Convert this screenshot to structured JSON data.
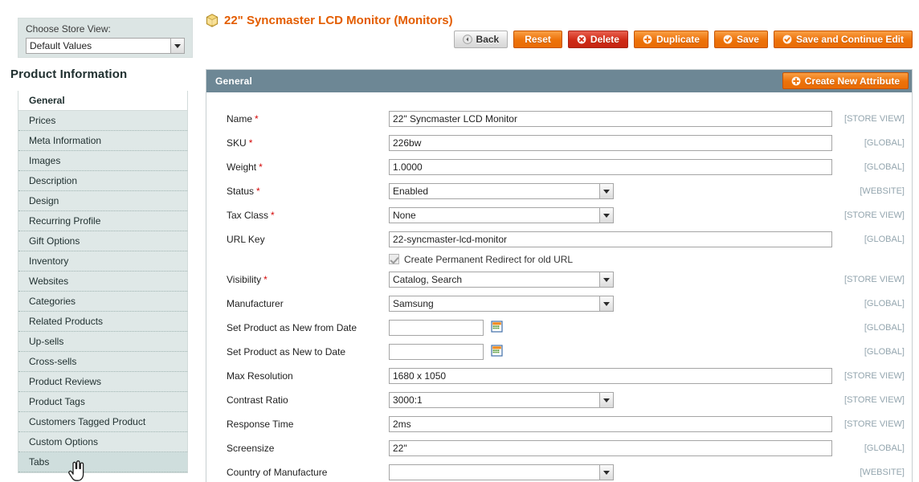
{
  "store_view": {
    "label": "Choose Store View:",
    "selected": "Default Values"
  },
  "sidebar": {
    "title": "Product Information",
    "items": [
      {
        "label": "General",
        "state": "active"
      },
      {
        "label": "Prices",
        "state": "normal"
      },
      {
        "label": "Meta Information",
        "state": "normal"
      },
      {
        "label": "Images",
        "state": "normal"
      },
      {
        "label": "Description",
        "state": "normal"
      },
      {
        "label": "Design",
        "state": "normal"
      },
      {
        "label": "Recurring Profile",
        "state": "normal"
      },
      {
        "label": "Gift Options",
        "state": "normal"
      },
      {
        "label": "Inventory",
        "state": "normal"
      },
      {
        "label": "Websites",
        "state": "normal"
      },
      {
        "label": "Categories",
        "state": "normal"
      },
      {
        "label": "Related Products",
        "state": "normal"
      },
      {
        "label": "Up-sells",
        "state": "normal"
      },
      {
        "label": "Cross-sells",
        "state": "normal"
      },
      {
        "label": "Product Reviews",
        "state": "normal"
      },
      {
        "label": "Product Tags",
        "state": "normal"
      },
      {
        "label": "Customers Tagged Product",
        "state": "normal"
      },
      {
        "label": "Custom Options",
        "state": "normal"
      },
      {
        "label": "Tabs",
        "state": "hovered"
      }
    ]
  },
  "header": {
    "title": "22\" Syncmaster LCD Monitor (Monitors)",
    "icon": "product-cube-icon",
    "buttons": [
      {
        "label": "Back",
        "style": "grey",
        "icon": "back-arrow-icon"
      },
      {
        "label": "Reset",
        "style": "orange",
        "icon": ""
      },
      {
        "label": "Delete",
        "style": "red",
        "icon": "delete-circle-icon"
      },
      {
        "label": "Duplicate",
        "style": "orange",
        "icon": "plus-circle-icon"
      },
      {
        "label": "Save",
        "style": "orange",
        "icon": "check-circle-icon"
      },
      {
        "label": "Save and Continue Edit",
        "style": "orange",
        "icon": "check-circle-icon"
      }
    ]
  },
  "section": {
    "title": "General",
    "create_attribute_label": "Create New Attribute",
    "create_attribute_icon": "plus-circle-icon"
  },
  "fields": [
    {
      "label": "Name",
      "required": true,
      "type": "text",
      "value": "22\" Syncmaster LCD Monitor",
      "scope": "[STORE VIEW]",
      "width": "wide"
    },
    {
      "label": "SKU",
      "required": true,
      "type": "text",
      "value": "226bw",
      "scope": "[GLOBAL]",
      "width": "wide"
    },
    {
      "label": "Weight",
      "required": true,
      "type": "text",
      "value": "1.0000",
      "scope": "[GLOBAL]",
      "width": "wide"
    },
    {
      "label": "Status",
      "required": true,
      "type": "select",
      "value": "Enabled",
      "scope": "[WEBSITE]",
      "width": "drop"
    },
    {
      "label": "Tax Class",
      "required": true,
      "type": "select",
      "value": "None",
      "scope": "[STORE VIEW]",
      "width": "drop"
    },
    {
      "label": "URL Key",
      "required": false,
      "type": "text",
      "value": "22-syncmaster-lcd-monitor",
      "scope": "[GLOBAL]",
      "width": "wide"
    },
    {
      "label": "Visibility",
      "required": true,
      "type": "select",
      "value": "Catalog, Search",
      "scope": "[STORE VIEW]",
      "width": "drop"
    },
    {
      "label": "Manufacturer",
      "required": false,
      "type": "select",
      "value": "Samsung",
      "scope": "[GLOBAL]",
      "width": "drop"
    },
    {
      "label": "Set Product as New from Date",
      "required": false,
      "type": "date",
      "value": "",
      "scope": "[GLOBAL]",
      "width": "date"
    },
    {
      "label": "Set Product as New to Date",
      "required": false,
      "type": "date",
      "value": "",
      "scope": "[GLOBAL]",
      "width": "date"
    },
    {
      "label": "Max Resolution",
      "required": false,
      "type": "text",
      "value": "1680 x 1050",
      "scope": "[STORE VIEW]",
      "width": "wide"
    },
    {
      "label": "Contrast Ratio",
      "required": false,
      "type": "select",
      "value": "3000:1",
      "scope": "[STORE VIEW]",
      "width": "drop"
    },
    {
      "label": "Response Time",
      "required": false,
      "type": "text",
      "value": "2ms",
      "scope": "[STORE VIEW]",
      "width": "wide"
    },
    {
      "label": "Screensize",
      "required": false,
      "type": "text",
      "value": "22\"",
      "scope": "[GLOBAL]",
      "width": "wide"
    },
    {
      "label": "Country of Manufacture",
      "required": false,
      "type": "select",
      "value": "",
      "scope": "[WEBSITE]",
      "width": "drop"
    }
  ],
  "url_key_checkbox": {
    "label": "Create Permanent Redirect for old URL",
    "checked": true
  },
  "colors": {
    "accent_orange": "#e35d01",
    "button_orange": "#ed7209",
    "delete_red": "#cf2a16",
    "section_header": "#6d8795",
    "sidebar_item": "#dfe8e7",
    "scope_text": "#93a5ae"
  }
}
